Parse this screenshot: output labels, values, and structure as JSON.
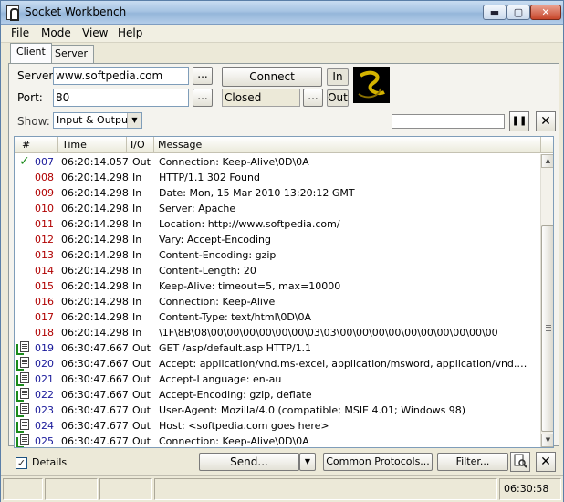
{
  "window": {
    "title": "Socket Workbench",
    "minimize": "▬",
    "maximize": "▢",
    "close": "✕"
  },
  "menu": [
    "File",
    "Mode",
    "View",
    "Help"
  ],
  "tabs": [
    "Client",
    "Server"
  ],
  "form": {
    "server_label": "Server:",
    "server_value": "www.softpedia.com",
    "port_label": "Port:",
    "port_value": "80",
    "connect_label": "Connect",
    "status_value": "Closed",
    "in_label": "In",
    "out_label": "Out",
    "dots": "...",
    "show_label": "Show:",
    "show_value": "Input & Output"
  },
  "toolbar": {
    "pause": "❚❚",
    "clear": "✕"
  },
  "columns": [
    "#",
    "Time",
    "I/O",
    "Message"
  ],
  "rows": [
    {
      "num": "007",
      "time": "06:20:14.057",
      "io": "Out",
      "msg": "Connection: Keep-Alive\\0D\\0A",
      "icon": "check-icon"
    },
    {
      "num": "008",
      "time": "06:20:14.298",
      "io": "In",
      "msg": "HTTP/1.1 302 Found",
      "icon": ""
    },
    {
      "num": "009",
      "time": "06:20:14.298",
      "io": "In",
      "msg": "Date: Mon, 15 Mar 2010 13:20:12 GMT",
      "icon": ""
    },
    {
      "num": "010",
      "time": "06:20:14.298",
      "io": "In",
      "msg": "Server: Apache",
      "icon": ""
    },
    {
      "num": "011",
      "time": "06:20:14.298",
      "io": "In",
      "msg": "Location: http://www.softpedia.com/",
      "icon": ""
    },
    {
      "num": "012",
      "time": "06:20:14.298",
      "io": "In",
      "msg": "Vary: Accept-Encoding",
      "icon": ""
    },
    {
      "num": "013",
      "time": "06:20:14.298",
      "io": "In",
      "msg": "Content-Encoding: gzip",
      "icon": ""
    },
    {
      "num": "014",
      "time": "06:20:14.298",
      "io": "In",
      "msg": "Content-Length: 20",
      "icon": ""
    },
    {
      "num": "015",
      "time": "06:20:14.298",
      "io": "In",
      "msg": "Keep-Alive: timeout=5, max=10000",
      "icon": ""
    },
    {
      "num": "016",
      "time": "06:20:14.298",
      "io": "In",
      "msg": "Connection: Keep-Alive",
      "icon": ""
    },
    {
      "num": "017",
      "time": "06:20:14.298",
      "io": "In",
      "msg": "Content-Type: text/html\\0D\\0A",
      "icon": ""
    },
    {
      "num": "018",
      "time": "06:20:14.298",
      "io": "In",
      "msg": "\\1F\\8B\\08\\00\\00\\00\\00\\00\\00\\03\\03\\00\\00\\00\\00\\00\\00\\00\\00\\00\\00",
      "icon": ""
    },
    {
      "num": "019",
      "time": "06:30:47.667",
      "io": "Out",
      "msg": "GET /asp/default.asp HTTP/1.1",
      "icon": "doc-check-icon"
    },
    {
      "num": "020",
      "time": "06:30:47.667",
      "io": "Out",
      "msg": "Accept: application/vnd.ms-excel, application/msword, application/vnd.ms-powerp...",
      "icon": "doc-check-icon"
    },
    {
      "num": "021",
      "time": "06:30:47.667",
      "io": "Out",
      "msg": "Accept-Language: en-au",
      "icon": "doc-check-icon"
    },
    {
      "num": "022",
      "time": "06:30:47.667",
      "io": "Out",
      "msg": "Accept-Encoding: gzip, deflate",
      "icon": "doc-check-icon"
    },
    {
      "num": "023",
      "time": "06:30:47.677",
      "io": "Out",
      "msg": "User-Agent: Mozilla/4.0 (compatible; MSIE 4.01; Windows 98)",
      "icon": "doc-check-icon"
    },
    {
      "num": "024",
      "time": "06:30:47.677",
      "io": "Out",
      "msg": "Host: <softpedia.com goes here>",
      "icon": "doc-check-icon"
    },
    {
      "num": "025",
      "time": "06:30:47.677",
      "io": "Out",
      "msg": "Connection: Keep-Alive\\0D\\0A",
      "icon": "doc-check-icon"
    }
  ],
  "bottom": {
    "details_label": "Details",
    "details_checked": true,
    "send_label": "Send...",
    "common_protocols_label": "Common Protocols...",
    "filter_label": "Filter...",
    "clear": "✕"
  },
  "status": {
    "time": "06:30:58"
  }
}
